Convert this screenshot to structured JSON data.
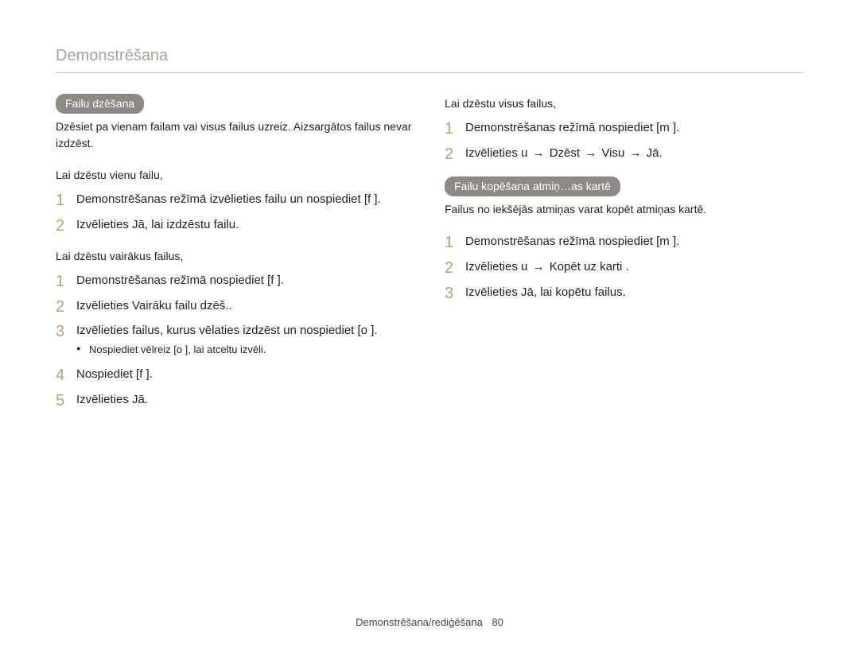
{
  "title": "Demonstrēšana",
  "footer": {
    "text": "Demonstrēšana/rediģēšana",
    "page": "80"
  },
  "left": {
    "section_title": "Failu dzēšana",
    "desc": "Dzēsiet pa vienam failam vai visus failus uzreiz. Aizsargātos failus nevar izdzēst.",
    "sub1": "Lai dzēstu vienu failu,",
    "steps1": [
      "Demonstrēšanas režīmā izvēlieties failu un nospiediet [f   ].",
      "Izvēlieties Jā, lai izdzēstu failu."
    ],
    "sub2": "Lai dzēstu vairākus failus,",
    "steps2": [
      "Demonstrēšanas režīmā nospiediet [f   ].",
      "Izvēlieties Vairāku failu dzēš..",
      "Izvēlieties failus, kurus vēlaties izdzēst un nospiediet [o ].",
      "Nospiediet [f   ].",
      "Izvēlieties Jā."
    ],
    "bullet": "Nospiediet vēlreiz [o ], lai atceltu izvēli."
  },
  "right": {
    "sub1": "Lai dzēstu visus failus,",
    "steps1": [
      {
        "parts": [
          "Demonstrēšanas režīmā nospiediet [m      ]."
        ]
      },
      {
        "parts": [
          "Izvēlieties u    ",
          "→",
          " Dzēst ",
          "→",
          " Visu ",
          "→",
          " Jā."
        ]
      }
    ],
    "section_title": "Failu kopēšana atmiņ…as kartē",
    "desc": "Failus no iekšējās atmiņas varat kopēt atmiņas kartē.",
    "steps2": [
      {
        "parts": [
          "Demonstrēšanas režīmā nospiediet [m      ]."
        ]
      },
      {
        "parts": [
          "Izvēlieties u    ",
          "→",
          " Kopēt uz karti ."
        ]
      },
      {
        "parts": [
          "Izvēlieties Jā, lai kopētu failus."
        ]
      }
    ]
  }
}
